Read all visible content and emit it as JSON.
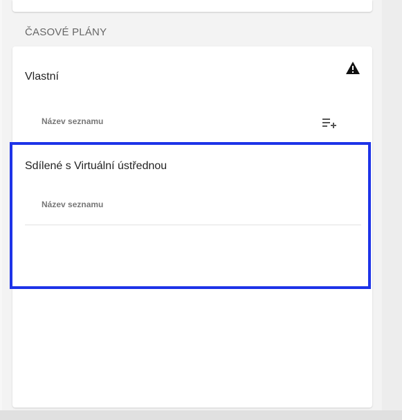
{
  "section": {
    "title": "ČASOVÉ PLÁNY"
  },
  "own": {
    "title": "Vlastní",
    "column_header": "Název seznamu"
  },
  "shared": {
    "title": "Sdílené s Virtuální ústřednou",
    "column_header": "Název seznamu"
  },
  "icons": {
    "warning": "warning-icon",
    "add_list": "playlist-add-icon"
  },
  "colors": {
    "highlight_border": "#1d33e8",
    "panel_background": "#f3f3f3",
    "card_background": "#ffffff",
    "section_text": "#666666"
  }
}
